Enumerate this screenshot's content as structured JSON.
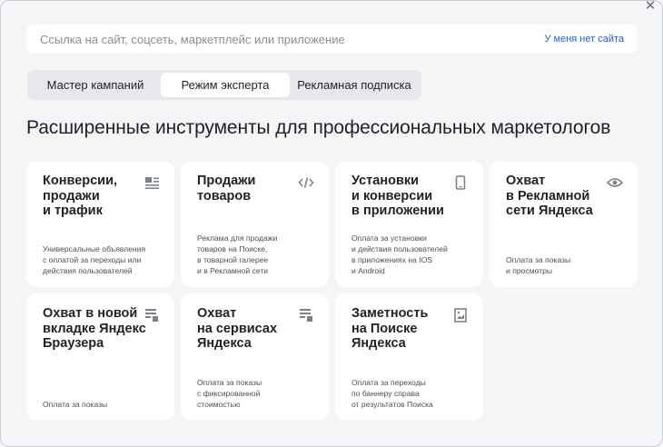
{
  "url_bar": {
    "placeholder": "Ссылка на сайт, соцсеть, маркетплейс или приложение",
    "no_site_link": "У меня нет сайта"
  },
  "close_icon": "close-icon",
  "tabs": [
    {
      "label": "Мастер кампаний",
      "selected": false
    },
    {
      "label": "Режим эксперта",
      "selected": true
    },
    {
      "label": "Рекламная подписка",
      "selected": false
    }
  ],
  "headline": "Расширенные инструменты для профессиональных маркетологов",
  "cards": [
    {
      "title": "Конверсии,\nпродажи\nи трафик",
      "desc": "Универсальные объявления\nс оплатой за переходы или\nдействия пользователей",
      "icon": "list-layout-icon"
    },
    {
      "title": "Продажи\nтоваров",
      "desc": "Реклама для продажи\nтоваров на Поиске,\nв товарной галерее\nи в Рекламной сети",
      "icon": "code-icon"
    },
    {
      "title": "Установки\nи конверсии\nв приложении",
      "desc": "Оплата за установки\nи действия пользователей\nв приложениях на IOS\nи Android",
      "icon": "smartphone-icon"
    },
    {
      "title": "Охват\nв Рекламной\nсети Яндекса",
      "desc": "Оплата за показы\nи просмотры",
      "icon": "eye-icon"
    },
    {
      "title": "Охват в новой\nвкладке Яндекс\nБраузера",
      "desc": "Оплата за показы",
      "icon": "browser-tab-icon"
    },
    {
      "title": "Охват\nна сервисах\nЯндекса",
      "desc": "Оплата за показы\nс фиксированной\nстоимостью",
      "icon": "services-icon"
    },
    {
      "title": "Заметность\nна Поиске\nЯндекса",
      "desc": "Оплата за переходы\nпо баннеру справа\nот результатов Поиска",
      "icon": "banner-image-icon"
    }
  ]
}
